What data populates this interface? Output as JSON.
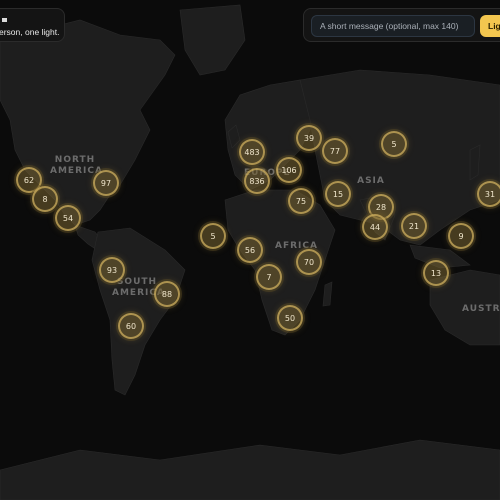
{
  "header": {
    "tagline": "erson, one light.",
    "message_placeholder": "A short message (optional, max 140)",
    "light_button_label": "Lig"
  },
  "map": {
    "continent_labels": {
      "north_america": "NORTH\nAMERICA",
      "south_america": "SOUTH\nAMERICA",
      "europe": "EUROPE",
      "africa": "AFRICA",
      "asia": "ASIA",
      "australia": "AUSTRA"
    },
    "clusters": [
      {
        "id": "c1",
        "count": "62"
      },
      {
        "id": "c2",
        "count": "8"
      },
      {
        "id": "c3",
        "count": "54"
      },
      {
        "id": "c4",
        "count": "97"
      },
      {
        "id": "c5",
        "count": "93"
      },
      {
        "id": "c6",
        "count": "88"
      },
      {
        "id": "c7",
        "count": "60"
      },
      {
        "id": "c8",
        "count": "5"
      },
      {
        "id": "c9",
        "count": "483"
      },
      {
        "id": "c10",
        "count": "836"
      },
      {
        "id": "c11",
        "count": "106"
      },
      {
        "id": "c12",
        "count": "39"
      },
      {
        "id": "c13",
        "count": "77"
      },
      {
        "id": "c14",
        "count": "75"
      },
      {
        "id": "c15",
        "count": "15"
      },
      {
        "id": "c16",
        "count": "56"
      },
      {
        "id": "c17",
        "count": "70"
      },
      {
        "id": "c18",
        "count": "7"
      },
      {
        "id": "c19",
        "count": "50"
      },
      {
        "id": "c20",
        "count": "5"
      },
      {
        "id": "c21",
        "count": "28"
      },
      {
        "id": "c22",
        "count": "44"
      },
      {
        "id": "c23",
        "count": "21"
      },
      {
        "id": "c24",
        "count": "9"
      },
      {
        "id": "c25",
        "count": "13"
      },
      {
        "id": "c26",
        "count": "31"
      }
    ]
  },
  "colors": {
    "background": "#0b0b0b",
    "land": "#1e1e1e",
    "cluster_ring": "#cdaf5f",
    "button_accent": "#f3c64f"
  }
}
